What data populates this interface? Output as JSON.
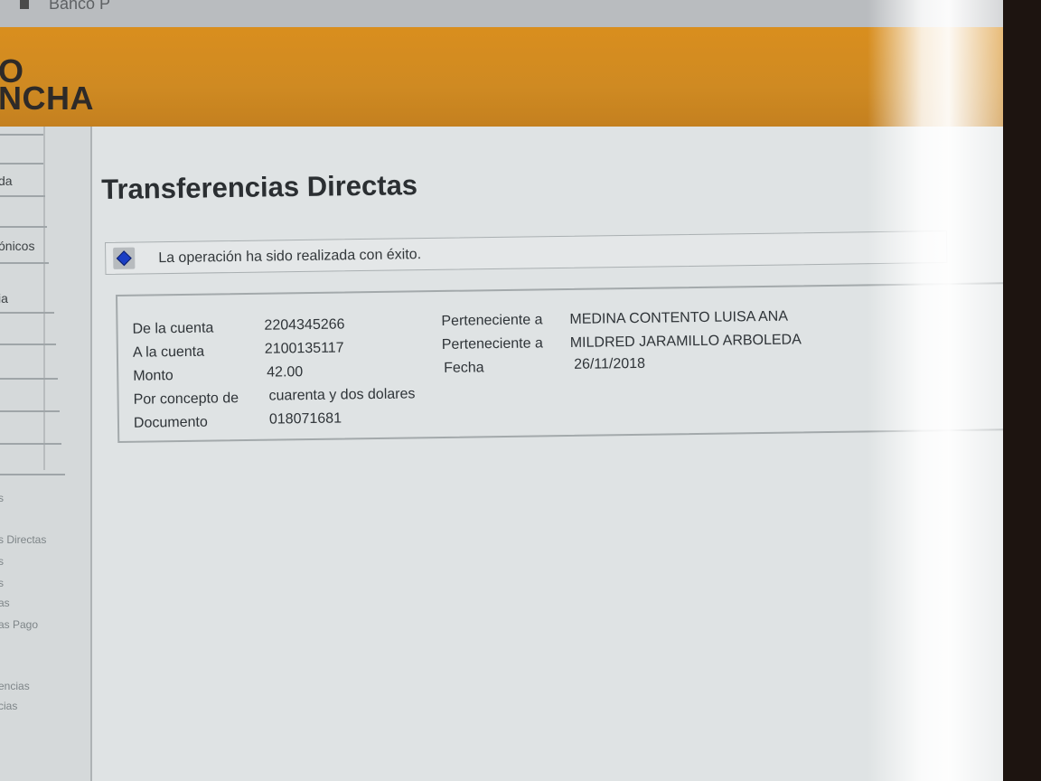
{
  "browser": {
    "title": "Banco P"
  },
  "bank": {
    "logo_line1": "O",
    "logo_line2": "NCHA"
  },
  "sidebar": {
    "items": [
      {
        "label": "da"
      },
      {
        "label": "ónicos"
      },
      {
        "label": "ia"
      },
      {
        "label": "s"
      },
      {
        "label": "s Directas"
      },
      {
        "label": "s"
      },
      {
        "label": "s"
      },
      {
        "label": "as"
      },
      {
        "label": "as Pago"
      },
      {
        "label": "encias"
      },
      {
        "label": "cias"
      }
    ]
  },
  "main": {
    "title": "Transferencias Directas",
    "message": "La operación ha sido realizada con éxito."
  },
  "details": {
    "from_label": "De la cuenta",
    "from_account": "2204345266",
    "from_owner_prefix": "Perteneciente a",
    "from_owner": "MEDINA CONTENTO LUISA ANA",
    "to_label": "A la cuenta",
    "to_account": "2100135117",
    "to_owner_prefix": "Perteneciente a",
    "to_owner": "MILDRED JARAMILLO ARBOLEDA",
    "amount_label": "Monto",
    "amount": "42.00",
    "date_label": "Fecha",
    "date": "26/11/2018",
    "concept_label": "Por concepto de",
    "concept": "cuarenta y dos dolares",
    "document_label": "Documento",
    "document": "018071681"
  }
}
